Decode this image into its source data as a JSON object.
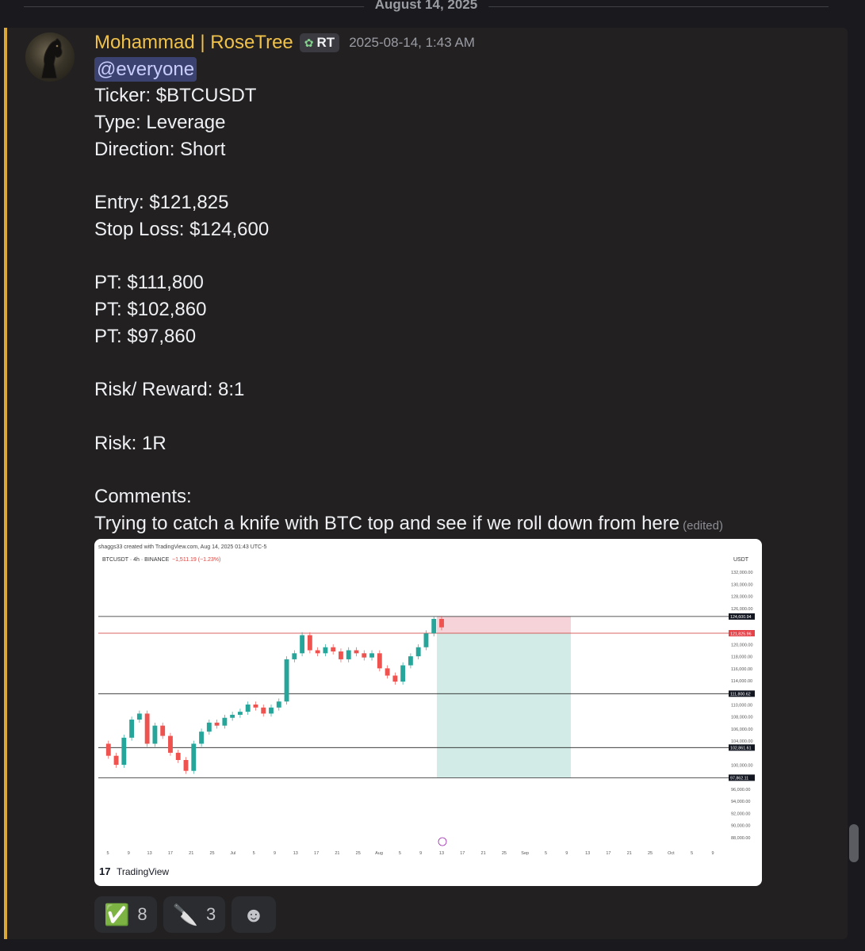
{
  "date_divider": "August 14, 2025",
  "message": {
    "author": "Mohammad | RoseTree",
    "role_tag": "RT",
    "role_icon": "leaf-icon",
    "timestamp": "2025-08-14, 1:43 AM",
    "mention": "@everyone",
    "lines": {
      "ticker": "Ticker: $BTCUSDT",
      "type": "Type: Leverage",
      "direction": "Direction: Short",
      "entry": "Entry: $121,825",
      "stop_loss": "Stop Loss: $124,600",
      "pt1": "PT: $111,800",
      "pt2": "PT: $102,860",
      "pt3": "PT: $97,860",
      "risk_reward": "Risk/ Reward: 8:1",
      "risk": "Risk: 1R",
      "comments_label": "Comments:",
      "comment": "Trying to catch a knife with BTC top and see if we roll down from here"
    },
    "edited_label": "(edited)",
    "colors": {
      "author": "#f0c24a",
      "accent_bar": "#d9a836",
      "mention_bg": "#3c4270"
    }
  },
  "chart_image": {
    "credit": "shaggs33 created with TradingView.com, Aug 14, 2025 01:43 UTC-5",
    "symbol": "BTCUSDT · 4h · BINANCE",
    "change": "−1,511.19 (−1.23%)",
    "currency": "USDT",
    "brand": "TradingView",
    "y_ticks": [
      "132,000.00",
      "130,000.00",
      "128,000.00",
      "126,000.00",
      "120,000.00",
      "118,000.00",
      "116,000.00",
      "114,000.00",
      "110,000.00",
      "108,000.00",
      "106,000.00",
      "104,000.00",
      "100,000.00",
      "96,000.00",
      "94,000.00",
      "92,000.00",
      "90,000.00",
      "88,000.00"
    ],
    "level_labels": [
      "124,600.94",
      "121,825.96",
      "111,800.62",
      "102,861.61",
      "97,862.11"
    ],
    "x_ticks": [
      "5",
      "9",
      "13",
      "17",
      "21",
      "25",
      "Jul",
      "5",
      "9",
      "13",
      "17",
      "21",
      "25",
      "Aug",
      "5",
      "9",
      "13",
      "17",
      "21",
      "25",
      "Sep",
      "5",
      "9",
      "13",
      "17",
      "21",
      "25",
      "Oct",
      "5",
      "9"
    ]
  },
  "chart_data": {
    "type": "line",
    "title": "",
    "xlabel": "",
    "ylabel": "USDT",
    "ylim": [
      87000,
      133000
    ],
    "y_ticks": [
      132000,
      130000,
      128000,
      126000,
      120000,
      118000,
      116000,
      114000,
      110000,
      108000,
      106000,
      104000,
      100000,
      96000,
      94000,
      92000,
      90000,
      88000
    ],
    "levels": [
      {
        "label": "Stop Loss",
        "value": 124600.94
      },
      {
        "label": "Entry",
        "value": 121825.96
      },
      {
        "label": "PT",
        "value": 111800.62
      },
      {
        "label": "PT",
        "value": 102861.61
      },
      {
        "label": "PT",
        "value": 97862.11
      }
    ],
    "series": [
      {
        "values": [
          103500,
          101500,
          100000,
          104500,
          107500,
          108500,
          103500,
          106500,
          104800,
          102000,
          100800,
          99000,
          103500,
          105500,
          107000,
          106500,
          107800,
          108300,
          108800,
          110000,
          109500,
          108500,
          109500,
          110500,
          117500,
          118500,
          121500,
          119000,
          118500,
          119500,
          118800,
          117500,
          119000,
          118500,
          117800,
          118500,
          116000,
          114800,
          113800,
          116500,
          118000,
          119500,
          121800,
          124200,
          122800
        ]
      }
    ]
  },
  "reactions": [
    {
      "emoji": "✅",
      "count": "8",
      "icon": "check-mark-icon"
    },
    {
      "emoji": "🔪",
      "count": "3",
      "icon": "knife-icon"
    },
    {
      "emoji": "☻",
      "count": "",
      "icon": "add-reaction-icon"
    }
  ]
}
